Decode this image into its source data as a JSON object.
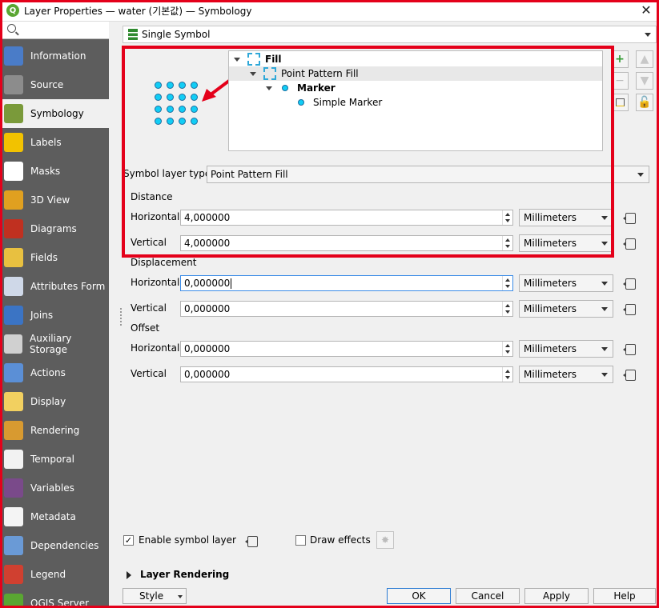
{
  "window": {
    "title": "Layer Properties — water (기본값) — Symbology",
    "close_glyph": "✕",
    "app_icon_letter": "Q"
  },
  "sidebar": {
    "search_placeholder": "",
    "items": [
      {
        "label": "Information",
        "icon": "information-icon",
        "color": "#4a7cc8"
      },
      {
        "label": "Source",
        "icon": "source-icon",
        "color": "#8c8c8c"
      },
      {
        "label": "Symbology",
        "icon": "symbology-icon",
        "color": "#7a9a3a",
        "active": true
      },
      {
        "label": "Labels",
        "icon": "labels-icon",
        "color": "#f2c200"
      },
      {
        "label": "Masks",
        "icon": "masks-icon",
        "color": "#ffffff"
      },
      {
        "label": "3D View",
        "icon": "3d-view-icon",
        "color": "#e0a020"
      },
      {
        "label": "Diagrams",
        "icon": "diagrams-icon",
        "color": "#c03020"
      },
      {
        "label": "Fields",
        "icon": "fields-icon",
        "color": "#e8c040"
      },
      {
        "label": "Attributes Form",
        "icon": "attributes-form-icon",
        "color": "#cfd8e8"
      },
      {
        "label": "Joins",
        "icon": "joins-icon",
        "color": "#3b74c4"
      },
      {
        "label": "Auxiliary Storage",
        "icon": "auxiliary-storage-icon",
        "color": "#d0d0d0"
      },
      {
        "label": "Actions",
        "icon": "actions-icon",
        "color": "#5b8fd6"
      },
      {
        "label": "Display",
        "icon": "display-icon",
        "color": "#f2d060"
      },
      {
        "label": "Rendering",
        "icon": "rendering-icon",
        "color": "#d89a30"
      },
      {
        "label": "Temporal",
        "icon": "temporal-icon",
        "color": "#f2f2f2"
      },
      {
        "label": "Variables",
        "icon": "variables-icon",
        "color": "#7a4a8a"
      },
      {
        "label": "Metadata",
        "icon": "metadata-icon",
        "color": "#f4f4f4"
      },
      {
        "label": "Dependencies",
        "icon": "dependencies-icon",
        "color": "#6a9ad6"
      },
      {
        "label": "Legend",
        "icon": "legend-icon",
        "color": "#d04030"
      },
      {
        "label": "QGIS Server",
        "icon": "qgis-server-icon",
        "color": "#5aa632"
      }
    ]
  },
  "renderer": {
    "selected": "Single Symbol"
  },
  "tree": {
    "fill": "Fill",
    "point_pattern_fill": "Point Pattern Fill",
    "marker": "Marker",
    "simple_marker": "Simple Marker"
  },
  "symbol_layer": {
    "type_label": "Symbol layer type",
    "type_value": "Point Pattern Fill"
  },
  "distance": {
    "title": "Distance",
    "horizontal_label": "Horizontal",
    "horizontal_value": "4,000000",
    "horizontal_unit": "Millimeters",
    "vertical_label": "Vertical",
    "vertical_value": "4,000000",
    "vertical_unit": "Millimeters"
  },
  "displacement": {
    "title": "Displacement",
    "horizontal_label": "Horizontal",
    "horizontal_value": "0,000000",
    "horizontal_unit": "Millimeters",
    "vertical_label": "Vertical",
    "vertical_value": "0,000000",
    "vertical_unit": "Millimeters"
  },
  "offset": {
    "title": "Offset",
    "horizontal_label": "Horizontal",
    "horizontal_value": "0,000000",
    "horizontal_unit": "Millimeters",
    "vertical_label": "Vertical",
    "vertical_value": "0,000000",
    "vertical_unit": "Millimeters"
  },
  "options": {
    "enable_symbol_layer": "Enable symbol layer",
    "enable_checked": "✓",
    "draw_effects": "Draw effects"
  },
  "layer_rendering": {
    "title": "Layer Rendering"
  },
  "buttons": {
    "style": "Style",
    "ok": "OK",
    "cancel": "Cancel",
    "apply": "Apply",
    "help": "Help"
  },
  "colors": {
    "highlight": "#e4001a",
    "marker_fill": "#11cdf5",
    "sidebar_bg": "#5d5d5d"
  }
}
